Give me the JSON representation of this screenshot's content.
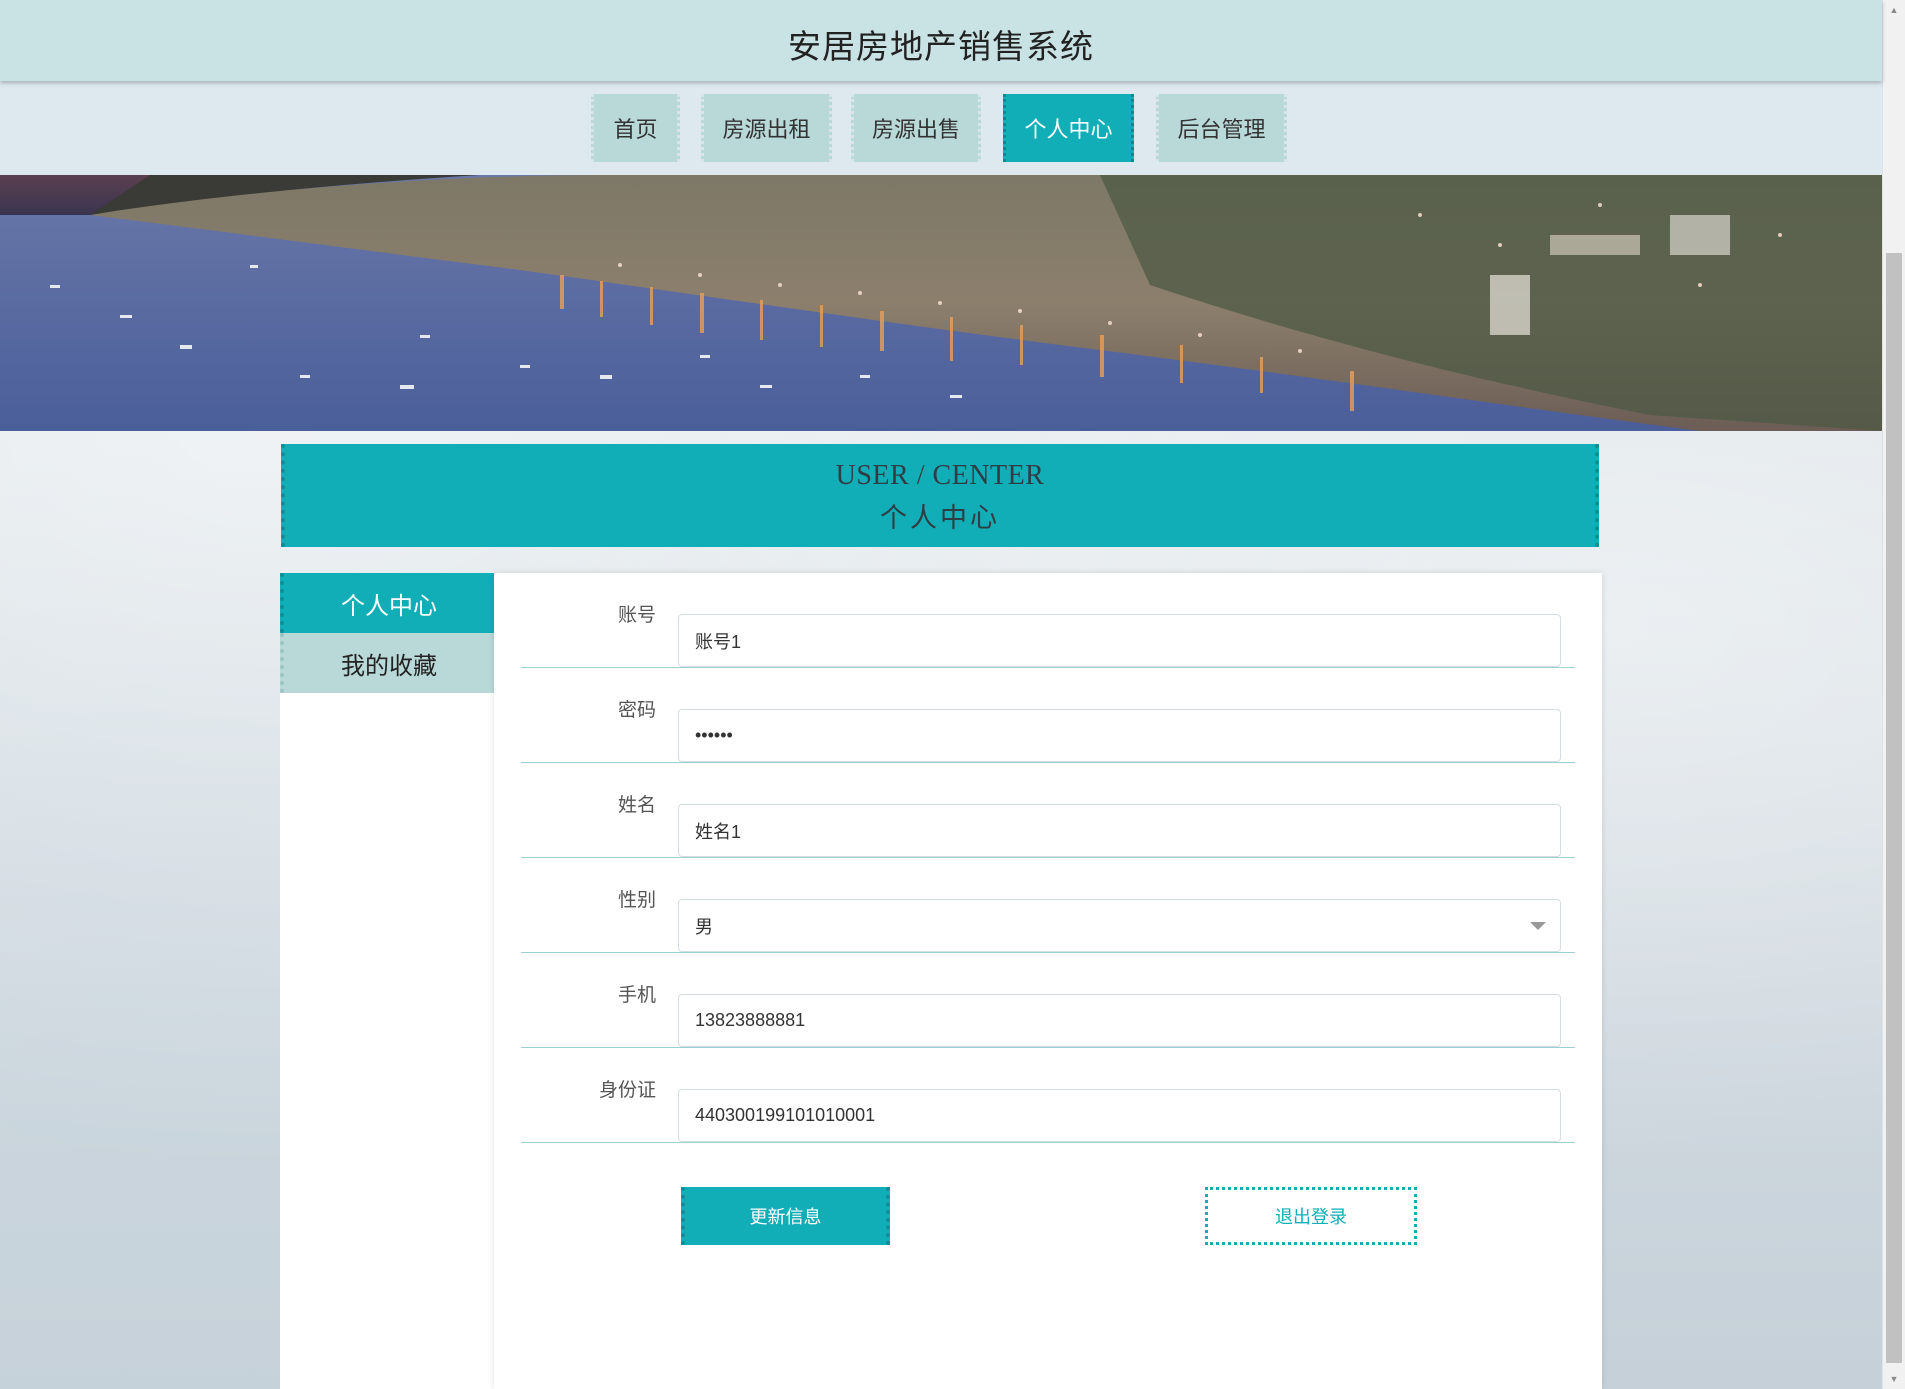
{
  "header": {
    "title": "安居房地产销售系统"
  },
  "nav": {
    "items": [
      {
        "label": "首页"
      },
      {
        "label": "房源出租"
      },
      {
        "label": "房源出售"
      },
      {
        "label": "个人中心",
        "active": true
      },
      {
        "label": "后台管理"
      }
    ]
  },
  "section": {
    "title_en": "USER / CENTER",
    "title_cn": "个人中心"
  },
  "sidebar": {
    "items": [
      {
        "label": "个人中心",
        "active": true
      },
      {
        "label": "我的收藏"
      }
    ]
  },
  "form": {
    "account": {
      "label": "账号",
      "value": "账号1"
    },
    "password": {
      "label": "密码",
      "value": "••••••"
    },
    "name": {
      "label": "姓名",
      "value": "姓名1"
    },
    "gender": {
      "label": "性别",
      "value": "男"
    },
    "phone": {
      "label": "手机",
      "value": "13823888881"
    },
    "id_card": {
      "label": "身份证",
      "value": "440300199101010001"
    }
  },
  "buttons": {
    "update": "更新信息",
    "logout": "退出登录"
  },
  "colors": {
    "accent": "#12aeb8",
    "header_bg": "#c9e2e4",
    "nav_item_bg": "#b9d8d8",
    "nav_bg": "#dde9ef"
  }
}
